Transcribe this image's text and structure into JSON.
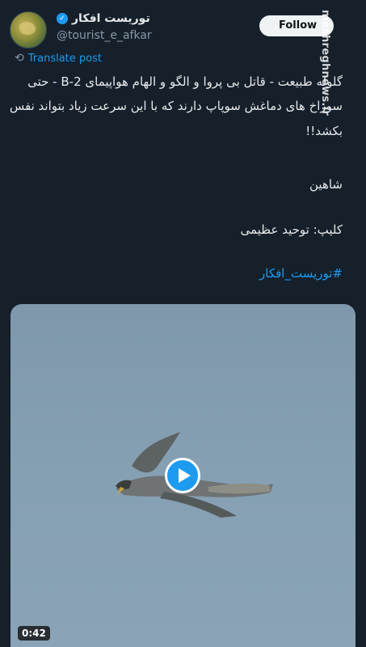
{
  "author": {
    "display_name": "توریست افکار",
    "handle": "@tourist_e_afkar",
    "verified_icon": "✓"
  },
  "follow_label": "Follow",
  "watermark": "mashreghnews.ir",
  "translate_label": "Translate post",
  "tweet": {
    "line1": "گلوله طبیعت - قاتل بی پروا و الگو و الهام هواپیمای B-2 - حتی",
    "line2": "سوراخ های دماغش سوپاپ دارند که با این سرعت زیاد بتواند نفس",
    "line3": "بکشد!!",
    "line4": "شاهین",
    "line5": "کلیپ: توحید عظیمی",
    "hashtag": "#توریست_افکار"
  },
  "video": {
    "duration": "0:42"
  }
}
